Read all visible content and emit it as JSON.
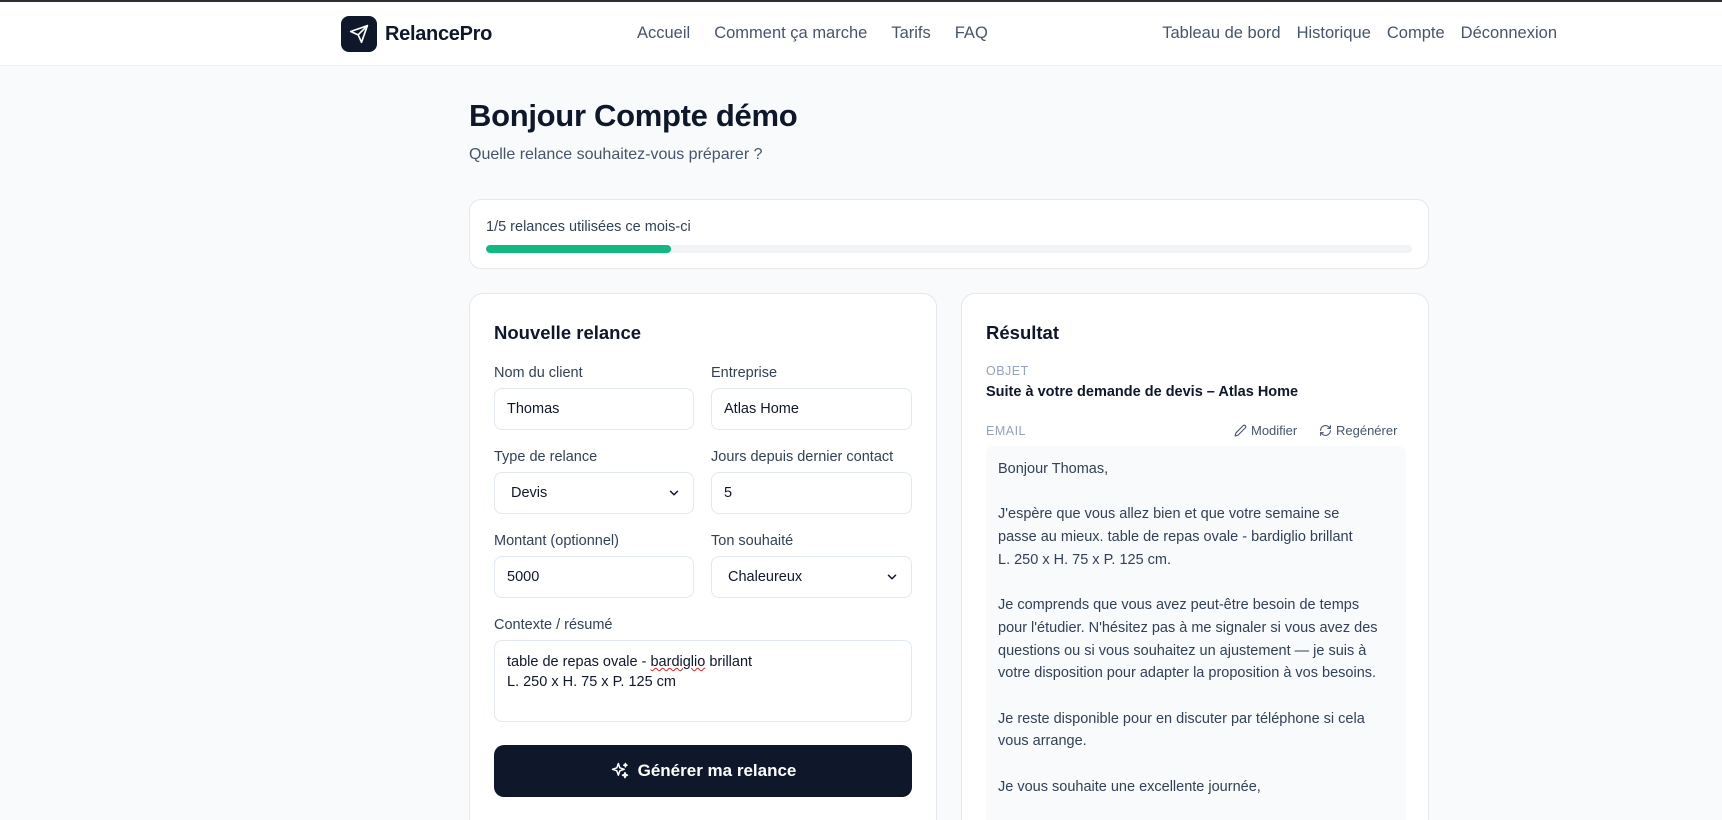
{
  "app": {
    "name": "RelancePro",
    "logo_icon": "paper-plane-icon"
  },
  "nav": {
    "center": [
      "Accueil",
      "Comment ça marche",
      "Tarifs",
      "FAQ"
    ],
    "right": [
      "Tableau de bord",
      "Historique",
      "Compte",
      "Déconnexion"
    ]
  },
  "greeting": {
    "title": "Bonjour Compte démo",
    "subtitle": "Quelle relance souhaitez-vous préparer ?"
  },
  "usage": {
    "text": "1/5 relances utilisées ce mois-ci",
    "used": 1,
    "limit": 5,
    "accent": "#10b981"
  },
  "form": {
    "title": "Nouvelle relance",
    "client_label": "Nom du client",
    "client_value": "Thomas",
    "company_label": "Entreprise",
    "company_value": "Atlas Home",
    "type_label": "Type de relance",
    "type_value": "Devis",
    "days_label": "Jours depuis dernier contact",
    "days_value": "5",
    "amount_label": "Montant (optionnel)",
    "amount_value": "5000",
    "tone_label": "Ton souhaité",
    "tone_value": "Chaleureux",
    "context_label": "Contexte / résumé",
    "context_line1_pre": "table de repas ovale - ",
    "context_line1_misspelled": "bardiglio",
    "context_line1_post": " brillant",
    "context_line2": "L. 250 x H. 75 x P. 125 cm",
    "generate_label": "Générer ma relance",
    "generate_icon": "sparkles-icon"
  },
  "result": {
    "title": "Résultat",
    "subject_label": "OBJET",
    "subject": "Suite à votre demande de devis – Atlas Home",
    "email_label": "EMAIL",
    "edit_label": "Modifier",
    "edit_icon": "pencil-icon",
    "regen_label": "Regénérer",
    "regen_icon": "refresh-icon",
    "email_lines": [
      "Bonjour Thomas,",
      "",
      "J'espère que vous allez bien et que votre semaine se",
      "passe au mieux. table de repas ovale - bardiglio brillant",
      "L. 250 x H. 75 x P. 125 cm.",
      "",
      "Je comprends que vous avez peut-être besoin de temps",
      "pour l'étudier. N'hésitez pas à me signaler si vous avez des",
      "questions ou si vous souhaitez un ajustement — je suis à",
      "votre disposition pour adapter la proposition à vos besoins.",
      "",
      "Je reste disponible pour en discuter par téléphone si cela",
      "vous arrange.",
      "",
      "Je vous souhaite une excellente journée,"
    ]
  }
}
